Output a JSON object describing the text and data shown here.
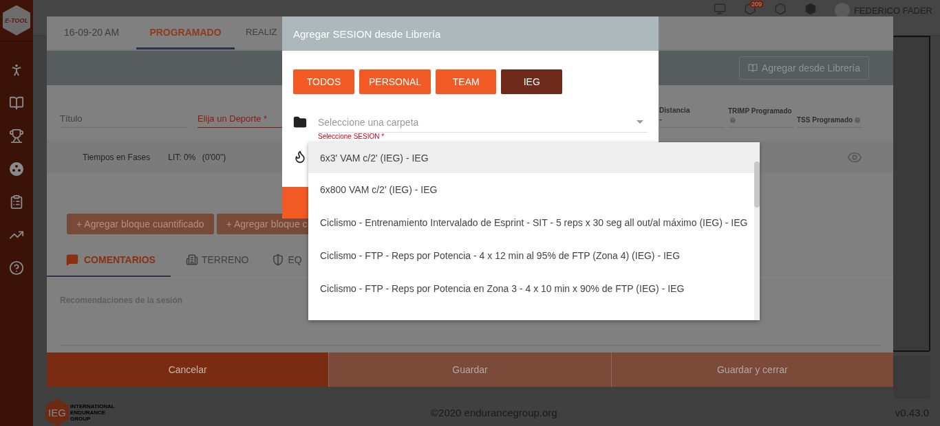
{
  "sidebar": {
    "logo": "E-TOOL"
  },
  "top_bar": {
    "notification_count": "209",
    "user_name": "FEDERICO FADER"
  },
  "session_dialog": {
    "tabs": [
      {
        "label": "16-09-20 AM",
        "selected": false
      },
      {
        "label": "PROGRAMADO",
        "selected": true
      },
      {
        "label": "REALIZ",
        "selected": false
      }
    ],
    "library_button": "Agregar desde Librería",
    "fields": [
      {
        "label": "Título",
        "error": false
      },
      {
        "label": "Elija un Deporte *",
        "error": true
      }
    ],
    "metrics": [
      {
        "label": "Distancia",
        "value": "-",
        "help": false
      },
      {
        "label": "TRIMP Programado",
        "help": true
      },
      {
        "label": "TSS Programado",
        "help": true
      }
    ],
    "phase_times": {
      "label": "Tiempos en Fases",
      "lit": "LIT: 0%",
      "duration": "(0'00\")"
    },
    "block_buttons": [
      "+ Agregar bloque cuantificado",
      "+ Agregar bloque c"
    ],
    "section_tabs": [
      {
        "label": "COMENTARIOS",
        "kind": "comment",
        "selected": true
      },
      {
        "label": "TERRENO",
        "kind": "terrain",
        "selected": false
      },
      {
        "label": "EQ",
        "kind": "shield",
        "selected": false
      }
    ],
    "comments_label": "Recomendaciones de la sesión",
    "footer_buttons": [
      {
        "label": "Cancelar",
        "kind": "cancel"
      },
      {
        "label": "Guardar",
        "kind": "save"
      },
      {
        "label": "Guardar y cerrar",
        "kind": "save"
      }
    ]
  },
  "library_dialog": {
    "title": "Agregar SESION desde Librería",
    "filters": [
      {
        "label": "TODOS",
        "selected": false
      },
      {
        "label": "PERSONAL",
        "selected": false
      },
      {
        "label": "TEAM",
        "selected": false
      },
      {
        "label": "IEG",
        "selected": true
      }
    ],
    "folder_select": {
      "placeholder": "Seleccione una carpeta"
    },
    "session_select": {
      "label": "Seleccione SESION *",
      "error": true
    },
    "options": [
      {
        "label": "6x3' VAM c/2' (IEG) - IEG",
        "selected": true
      },
      {
        "label": "6x800 VAM c/2' (IEG) - IEG",
        "selected": false
      },
      {
        "label": "Ciclismo - Entrenamiento Intervalado de Esprint - SIT - 5 reps x 30 seg all out/al máximo (IEG) - IEG",
        "selected": false
      },
      {
        "label": "Ciclismo - FTP - Reps por Potencia - 4 x 12 min al 95% de FTP (Zona 4) (IEG) - IEG",
        "selected": false
      },
      {
        "label": "Ciclismo - FTP - Reps por Potencia en Zona 3 - 4 x 10 min x 90% de FTP (IEG) - IEG",
        "selected": false
      }
    ]
  },
  "footer": {
    "logo": "IEG",
    "logo_caption": [
      "INTERNATIONAL",
      "ENDURANCE",
      "GROUP"
    ],
    "copyright": "©2020 endurancegroup.org",
    "version": "v0.43.0"
  }
}
